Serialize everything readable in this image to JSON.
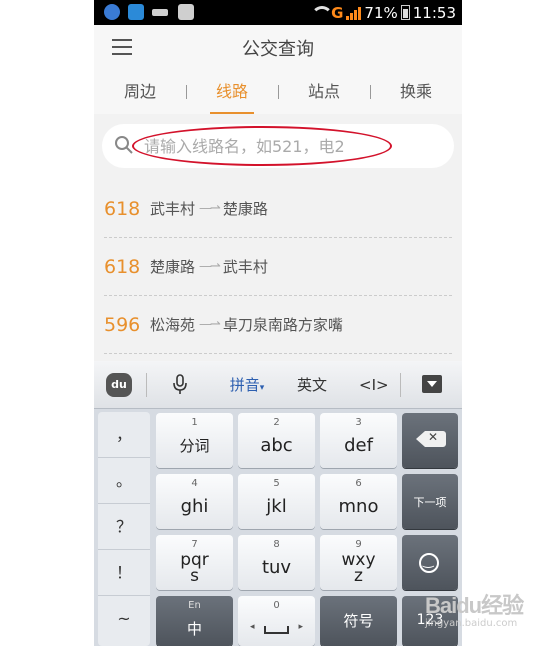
{
  "status_bar": {
    "network": "G",
    "battery": "71%",
    "time": "11:53"
  },
  "app": {
    "title": "公交查询"
  },
  "tabs": [
    {
      "label": "周边",
      "active": false
    },
    {
      "label": "线路",
      "active": true
    },
    {
      "label": "站点",
      "active": false
    },
    {
      "label": "换乘",
      "active": false
    }
  ],
  "search": {
    "placeholder": "请输入线路名，如521，电2"
  },
  "routes": [
    {
      "number": "618",
      "from": "武丰村",
      "to": "楚康路"
    },
    {
      "number": "618",
      "from": "楚康路",
      "to": "武丰村"
    },
    {
      "number": "596",
      "from": "松海苑",
      "to": "卓刀泉南路方家嘴"
    }
  ],
  "keyboard": {
    "toolbar": {
      "logo": "du",
      "pinyin": "拼音",
      "english": "英文"
    },
    "symbols": [
      "，",
      "。",
      "？",
      "！",
      "~"
    ],
    "keys": {
      "k1": {
        "num": "1",
        "label": "分词"
      },
      "k2": {
        "num": "2",
        "label": "abc"
      },
      "k3": {
        "num": "3",
        "label": "def"
      },
      "k4": {
        "num": "4",
        "label": "ghi"
      },
      "k5": {
        "num": "5",
        "label": "jkl"
      },
      "k6": {
        "num": "6",
        "label": "mno"
      },
      "k7": {
        "num": "7",
        "label": "pqr\ns"
      },
      "k8": {
        "num": "8",
        "label": "tuv"
      },
      "k9": {
        "num": "9",
        "label": "wxy\nz"
      },
      "next": "下一项",
      "lang": {
        "num": "En",
        "label": "中"
      },
      "space": {
        "num": "0"
      },
      "symbol": "符号",
      "numbers": "123"
    }
  },
  "watermark": {
    "logo": "Baidu经验",
    "sub": "jingyan.baidu.com"
  },
  "colors": {
    "accent": "#e8902d",
    "highlight_circle": "#d3122b"
  }
}
